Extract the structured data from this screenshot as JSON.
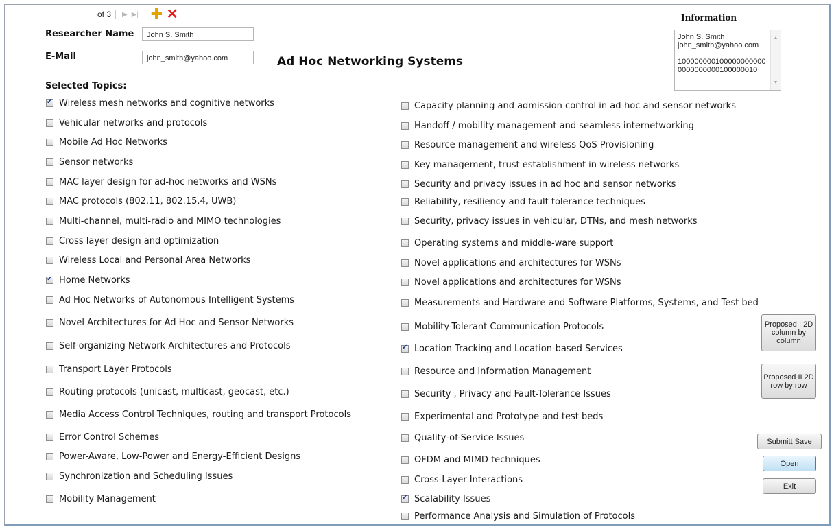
{
  "nav": {
    "record_label": "of 3"
  },
  "form": {
    "researcher_label": "Researcher Name",
    "researcher_value": "John S. Smith",
    "email_label": "E-Mail",
    "email_value": "john_smith@yahoo.com",
    "title": "Ad Hoc Networking Systems",
    "selected_topics_label": "Selected Topics:"
  },
  "information": {
    "title": "Information",
    "lines": [
      "John S. Smith",
      "john_smith@yahoo.com",
      "",
      "1000000001000000000000000000000100000010"
    ]
  },
  "topics_left": [
    {
      "label": "Wireless mesh networks and cognitive networks",
      "checked": true
    },
    {
      "label": "Vehicular networks and protocols",
      "checked": false
    },
    {
      "label": "Mobile Ad Hoc Networks",
      "checked": false
    },
    {
      "label": "Sensor networks",
      "checked": false
    },
    {
      "label": "MAC layer design for ad-hoc networks and WSNs",
      "checked": false
    },
    {
      "label": "MAC protocols (802.11, 802.15.4, UWB)",
      "checked": false
    },
    {
      "label": "Multi-channel, multi-radio and MIMO technologies",
      "checked": false
    },
    {
      "label": "Cross layer design and optimization",
      "checked": false
    },
    {
      "label": "Wireless Local and Personal Area Networks",
      "checked": false
    },
    {
      "label": "Home Networks",
      "checked": true
    },
    {
      "label": "Ad Hoc Networks of Autonomous Intelligent Systems",
      "checked": false
    },
    {
      "label": "Novel Architectures for Ad Hoc and Sensor Networks",
      "checked": false
    },
    {
      "label": "Self-organizing Network Architectures and Protocols",
      "checked": false
    },
    {
      "label": "Transport Layer Protocols",
      "checked": false
    },
    {
      "label": "Routing protocols (unicast, multicast, geocast, etc.)",
      "checked": false
    },
    {
      "label": "Media Access Control Techniques, routing and transport Protocols",
      "checked": false
    },
    {
      "label": "Error Control Schemes",
      "checked": false
    },
    {
      "label": "Power-Aware, Low-Power and Energy-Efficient Designs",
      "checked": false
    },
    {
      "label": "Synchronization and Scheduling Issues",
      "checked": false
    },
    {
      "label": "Mobility Management",
      "checked": false
    }
  ],
  "topics_right": [
    {
      "label": "Capacity planning and admission control in ad-hoc and sensor networks",
      "checked": false
    },
    {
      "label": "Handoff / mobility management and seamless internetworking",
      "checked": false
    },
    {
      "label": "Resource management and wireless QoS Provisioning",
      "checked": false
    },
    {
      "label": "Key management, trust establishment in wireless networks",
      "checked": false
    },
    {
      "label": "Security and privacy issues in ad hoc and sensor networks",
      "checked": false
    },
    {
      "label": "Reliability, resiliency and fault tolerance techniques",
      "checked": false
    },
    {
      "label": "Security, privacy issues in vehicular, DTNs, and mesh networks",
      "checked": false
    },
    {
      "label": "Operating systems and middle-ware support",
      "checked": false
    },
    {
      "label": "Novel applications and architectures for WSNs",
      "checked": false
    },
    {
      "label": "Novel applications and architectures for WSNs",
      "checked": false
    },
    {
      "label": "Measurements and Hardware and Software Platforms, Systems, and Test bed",
      "checked": false
    },
    {
      "label": "Mobility-Tolerant Communication Protocols",
      "checked": false
    },
    {
      "label": "Location Tracking and Location-based Services",
      "checked": true
    },
    {
      "label": "Resource and Information Management",
      "checked": false
    },
    {
      "label": "Security , Privacy and Fault-Tolerance Issues",
      "checked": false
    },
    {
      "label": "Experimental and Prototype and test beds",
      "checked": false
    },
    {
      "label": "Quality-of-Service Issues",
      "checked": false
    },
    {
      "label": "OFDM and MIMD techniques",
      "checked": false
    },
    {
      "label": "Cross-Layer Interactions",
      "checked": false
    },
    {
      "label": "Scalability Issues",
      "checked": true
    },
    {
      "label": "Performance Analysis and Simulation of Protocols",
      "checked": false
    }
  ],
  "buttons": {
    "proposed1": "Proposed I 2D column by column",
    "proposed2": "Proposed II 2D row by row",
    "submit": "Submitt Save",
    "open": "Open",
    "exit": "Exit"
  }
}
